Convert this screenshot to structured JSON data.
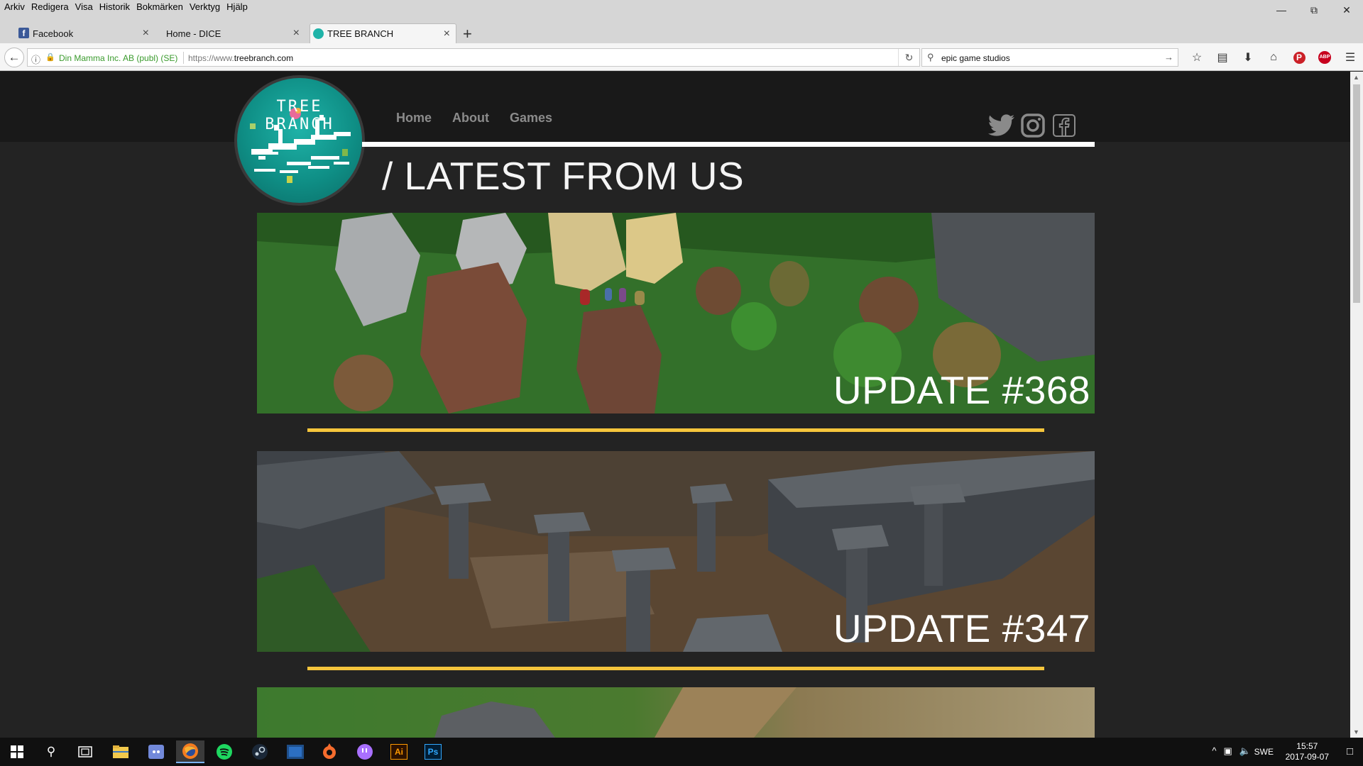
{
  "browser": {
    "menus": [
      "Arkiv",
      "Redigera",
      "Visa",
      "Historik",
      "Bokmärken",
      "Verktyg",
      "Hjälp"
    ],
    "tabs": [
      {
        "title": "Facebook",
        "favicon_color": "#3b5998"
      },
      {
        "title": "Home - DICE",
        "favicon_color": ""
      },
      {
        "title": "TREE BRANCH",
        "favicon_color": "#1fb3a8"
      }
    ],
    "new_tab_symbol": "+",
    "identity": "Din Mamma Inc. AB (publ) (SE)",
    "url_prefix": "https://www.",
    "url_domain": "treebranch.com",
    "search_query": "epic game studios",
    "toolbar_icons": [
      "star-icon",
      "reading-list-icon",
      "download-icon",
      "home-icon",
      "pinterest-icon",
      "adblock-icon",
      "hamburger-menu-icon"
    ],
    "adblock_label": "ABP"
  },
  "site": {
    "logo_text": "TREE BRANCH",
    "nav": [
      "Home",
      "About",
      "Games"
    ],
    "social": [
      "twitter-icon",
      "instagram-icon",
      "facebook-icon"
    ],
    "section_title": "/ LATEST FROM US",
    "posts": [
      {
        "title": "UPDATE #368"
      },
      {
        "title": "UPDATE #347"
      },
      {
        "title": ""
      }
    ],
    "colors": {
      "header_bg": "#191919",
      "page_bg": "#232323",
      "accent_yellow": "#f5c53c",
      "nav_text": "#8b8b8b",
      "logo_teal": "#1fb3a8"
    }
  },
  "taskbar": {
    "apps": [
      "start-icon",
      "search-icon",
      "task-view-icon",
      "file-explorer-icon",
      "discord-icon",
      "firefox-icon",
      "spotify-icon",
      "steam-icon",
      "battlenet-icon",
      "origin-icon",
      "twitch-icon",
      "illustrator-icon",
      "photoshop-icon"
    ],
    "illustrator_label": "Ai",
    "photoshop_label": "Ps",
    "language": "SWE",
    "time": "15:57",
    "date": "2017-09-07"
  }
}
